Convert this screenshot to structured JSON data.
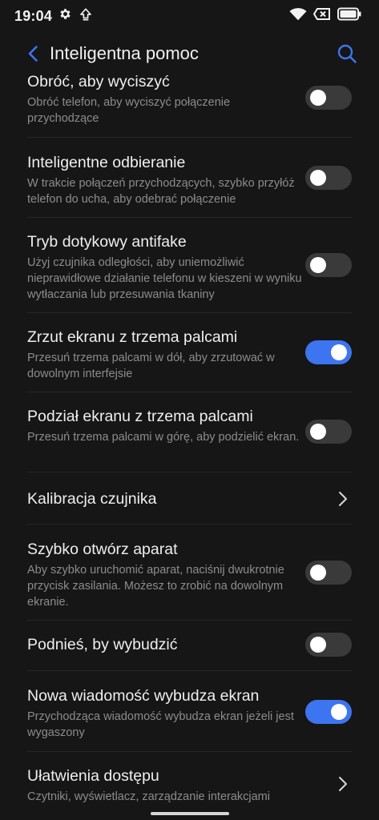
{
  "status": {
    "time": "19:04",
    "icons": [
      "gear-icon",
      "upload-arrow-icon",
      "wifi-icon",
      "no-sim-icon",
      "battery-icon"
    ]
  },
  "header": {
    "title": "Inteligentna pomoc",
    "back_icon": "chevron-left-icon",
    "search_icon": "search-icon",
    "accent": "#3d74f0"
  },
  "items": [
    {
      "title": "Obróć, aby wyciszyć",
      "desc": "Obróć telefon, aby wyciszyć połączenie przychodzące",
      "control": "toggle",
      "on": false
    },
    {
      "title": "Inteligentne odbieranie",
      "desc": "W trakcie połączeń przychodzących, szybko przyłóż telefon do ucha, aby odebrać połączenie",
      "control": "toggle",
      "on": false
    },
    {
      "title": "Tryb dotykowy antifake",
      "desc": "Użyj czujnika odległości, aby uniemożliwić nieprawidłowe działanie telefonu w kieszeni w wyniku wytłaczania lub przesuwania tkaniny",
      "control": "toggle",
      "on": false
    },
    {
      "title": "Zrzut ekranu z trzema palcami",
      "desc": "Przesuń trzema palcami w dół, aby zrzutować w dowolnym interfejsie",
      "control": "toggle",
      "on": true
    },
    {
      "title": "Podział ekranu z trzema palcami",
      "desc": "Przesuń trzema palcami w górę, aby podzielić ekran.",
      "control": "toggle",
      "on": false
    },
    {
      "title": "Kalibracja czujnika",
      "desc": "",
      "control": "chevron"
    },
    {
      "title": "Szybko otwórz aparat",
      "desc": "Aby szybko uruchomić aparat, naciśnij dwukrotnie przycisk zasilania. Możesz to zrobić na dowolnym ekranie.",
      "control": "toggle",
      "on": false
    },
    {
      "title": "Podnieś, by wybudzić",
      "desc": "",
      "control": "toggle",
      "on": false
    },
    {
      "title": "Nowa wiadomość wybudza ekran",
      "desc": "Przychodząca wiadomość wybudza ekran jeżeli jest wygaszony",
      "control": "toggle",
      "on": true
    },
    {
      "title": "Ułatwienia dostępu",
      "desc": "Czytniki, wyświetlacz, zarządzanie interakcjami",
      "control": "chevron"
    }
  ]
}
